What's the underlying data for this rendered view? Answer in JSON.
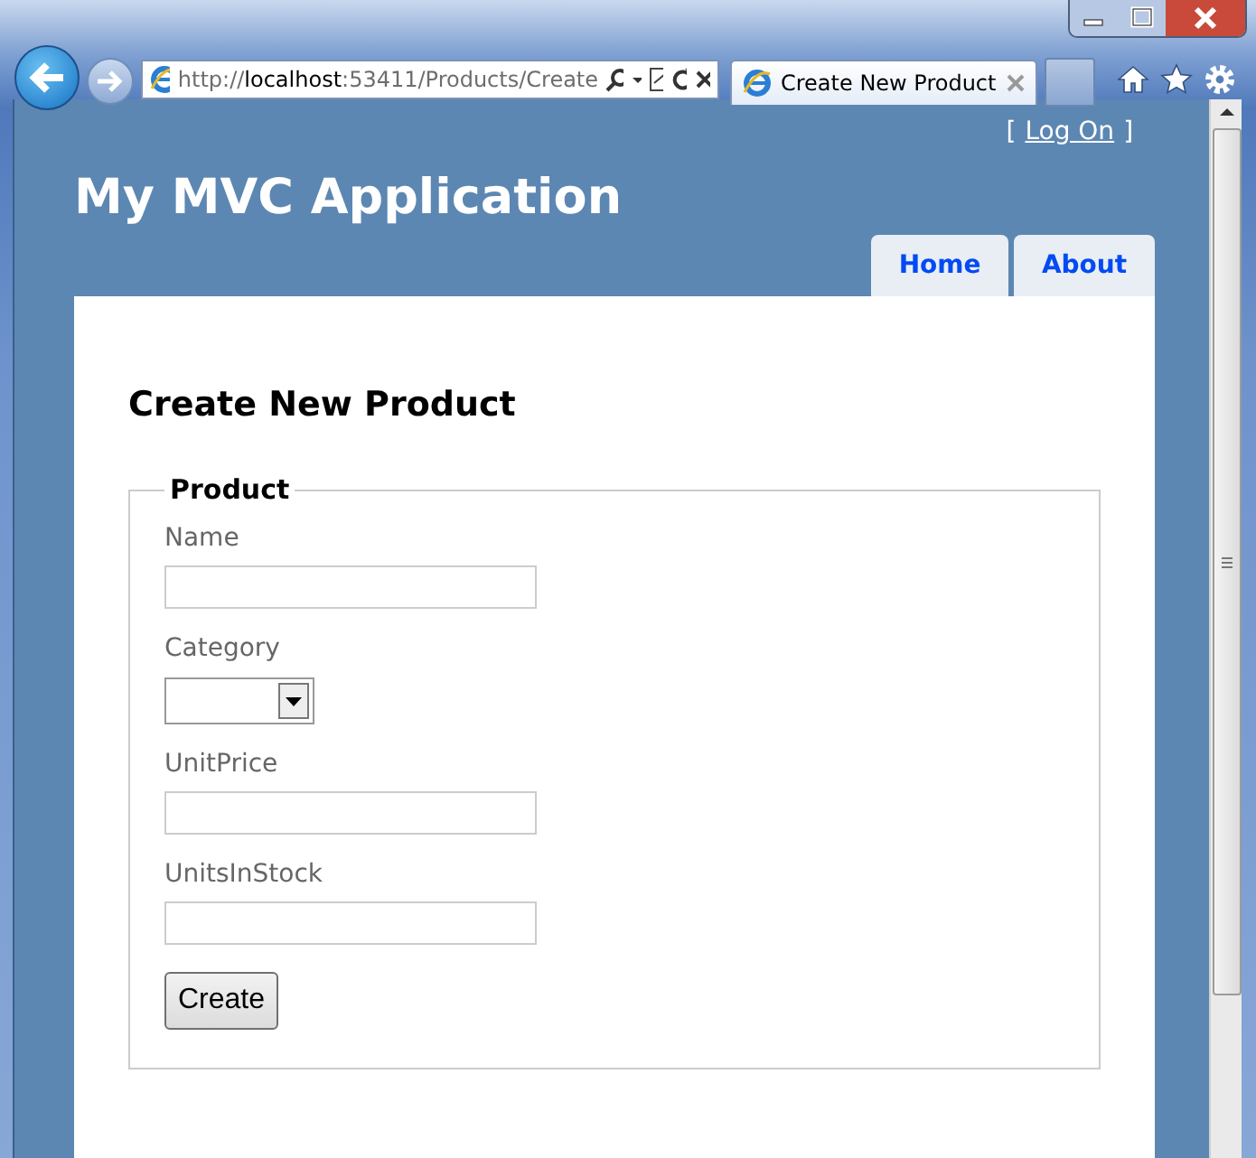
{
  "browser": {
    "address": {
      "scheme": "http://",
      "host": "localhost",
      "rest": ":53411/Products/Create"
    },
    "tab": {
      "title": "Create New Product"
    }
  },
  "page": {
    "login": {
      "open": "[",
      "link": "Log On",
      "close": "]"
    },
    "site_title": "My MVC Application",
    "menu": [
      {
        "label": "Home"
      },
      {
        "label": "About"
      }
    ],
    "heading": "Create New Product",
    "form": {
      "legend": "Product",
      "fields": [
        {
          "label": "Name",
          "kind": "text"
        },
        {
          "label": "Category",
          "kind": "select"
        },
        {
          "label": "UnitPrice",
          "kind": "text"
        },
        {
          "label": "UnitsInStock",
          "kind": "text"
        }
      ],
      "submit": "Create"
    }
  }
}
